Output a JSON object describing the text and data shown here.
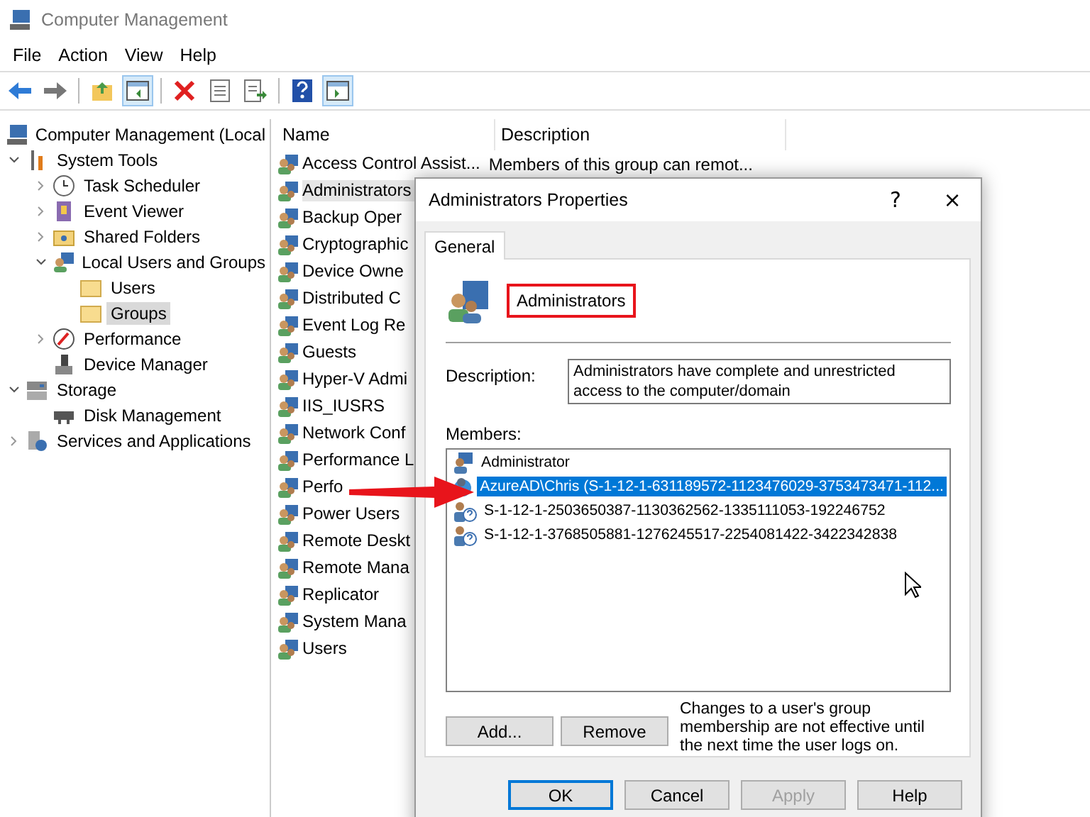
{
  "window": {
    "title": "Computer Management"
  },
  "menu": [
    "File",
    "Action",
    "View",
    "Help"
  ],
  "toolbar": [
    {
      "kind": "back",
      "pressed": false
    },
    {
      "kind": "forward",
      "pressed": false
    },
    {
      "kind": "sep"
    },
    {
      "kind": "up",
      "pressed": false
    },
    {
      "kind": "tree",
      "pressed": true
    },
    {
      "kind": "sep"
    },
    {
      "kind": "delete",
      "pressed": false
    },
    {
      "kind": "properties",
      "pressed": false
    },
    {
      "kind": "export",
      "pressed": false
    },
    {
      "kind": "sep"
    },
    {
      "kind": "help",
      "pressed": false
    },
    {
      "kind": "actionpane",
      "pressed": true
    }
  ],
  "tree": [
    {
      "label": "Computer Management (Local",
      "kind": "computer",
      "selected": false,
      "children": [
        {
          "label": "System Tools",
          "kind": "tools",
          "expanded": true,
          "selected": false,
          "children": [
            {
              "label": "Task Scheduler",
              "kind": "clock",
              "expanded": false,
              "selected": false
            },
            {
              "label": "Event Viewer",
              "kind": "log",
              "expanded": false,
              "selected": false
            },
            {
              "label": "Shared Folders",
              "kind": "share",
              "expanded": false,
              "selected": false
            },
            {
              "label": "Local Users and Groups",
              "kind": "group",
              "expanded": true,
              "selected": false,
              "children": [
                {
                  "label": "Users",
                  "kind": "folder",
                  "selected": false
                },
                {
                  "label": "Groups",
                  "kind": "folder",
                  "selected": true
                }
              ]
            },
            {
              "label": "Performance",
              "kind": "gauge",
              "expanded": false,
              "selected": false
            },
            {
              "label": "Device Manager",
              "kind": "device",
              "selected": false
            }
          ]
        },
        {
          "label": "Storage",
          "kind": "storage",
          "expanded": true,
          "selected": false,
          "children": [
            {
              "label": "Disk Management",
              "kind": "disk",
              "selected": false
            }
          ]
        },
        {
          "label": "Services and Applications",
          "kind": "services",
          "expanded": false,
          "selected": false
        }
      ]
    }
  ],
  "list": {
    "columns": [
      "Name",
      "Description"
    ],
    "rows": [
      {
        "name": "Access Control Assist...",
        "description": "Members of this group can remot...",
        "selected": false
      },
      {
        "name": "Administrators",
        "selected": true
      },
      {
        "name": "Backup Oper",
        "selected": false
      },
      {
        "name": "Cryptographic",
        "selected": false
      },
      {
        "name": "Device Owne",
        "selected": false
      },
      {
        "name": "Distributed C",
        "selected": false
      },
      {
        "name": "Event Log Re",
        "selected": false
      },
      {
        "name": "Guests",
        "selected": false
      },
      {
        "name": "Hyper-V Admi",
        "selected": false
      },
      {
        "name": "IIS_IUSRS",
        "selected": false
      },
      {
        "name": "Network Conf",
        "selected": false
      },
      {
        "name": "Performance L",
        "selected": false
      },
      {
        "name": "Perfo",
        "selected": false
      },
      {
        "name": "Power Users",
        "selected": false
      },
      {
        "name": "Remote Deskt",
        "selected": false
      },
      {
        "name": "Remote Mana",
        "selected": false
      },
      {
        "name": "Replicator",
        "selected": false
      },
      {
        "name": "System Mana",
        "selected": false
      },
      {
        "name": "Users",
        "selected": false
      }
    ]
  },
  "dialog": {
    "title": "Administrators Properties",
    "help": "?",
    "close": "×",
    "tabs": [
      {
        "label": "General",
        "selected": true
      }
    ],
    "group_name": "Administrators",
    "description_label": "Description:",
    "description": "Administrators have complete and unrestricted access to the computer/domain",
    "members_label": "Members:",
    "members": [
      {
        "name": "Administrator",
        "kind": "user",
        "selected": false
      },
      {
        "name": "AzureAD\\Chris (S-1-12-1-631189572-1123476029-3753473471-112...",
        "kind": "azure",
        "selected": true
      },
      {
        "name": "S-1-12-1-2503650387-1130362562-1335111053-192246752",
        "kind": "unknown",
        "selected": false
      },
      {
        "name": "S-1-12-1-3768505881-1276245517-2254081422-3422342838",
        "kind": "unknown",
        "selected": false
      }
    ],
    "member_buttons": [
      "Add...",
      "Remove"
    ],
    "note": "Changes to a user's group membership are not effective until the next time the user logs on.",
    "buttons": [
      {
        "label": "OK",
        "default": true,
        "disabled": false
      },
      {
        "label": "Cancel",
        "default": false,
        "disabled": false
      },
      {
        "label": "Apply",
        "default": false,
        "disabled": true
      },
      {
        "label": "Help",
        "default": false,
        "disabled": false
      }
    ]
  }
}
